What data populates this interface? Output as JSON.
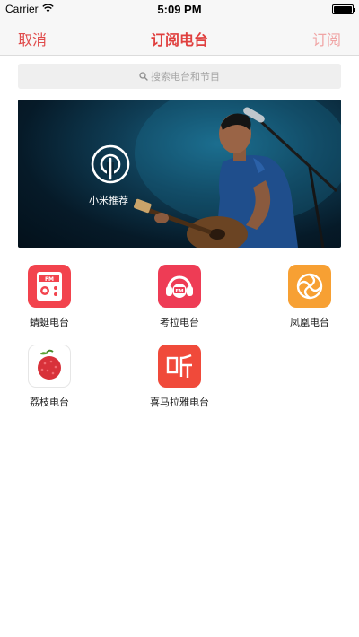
{
  "status_bar": {
    "carrier": "Carrier",
    "time": "5:09 PM"
  },
  "nav": {
    "cancel_label": "取消",
    "title": "订阅电台",
    "subscribe_label": "订阅"
  },
  "search": {
    "placeholder": "搜索电台和节目"
  },
  "banner": {
    "label": "小米推荐"
  },
  "stations": [
    {
      "name": "蜻蜓电台",
      "icon": "radio-icon",
      "color": "#f2434d"
    },
    {
      "name": "考拉电台",
      "icon": "koala-fm-icon",
      "color": "#ee3c55"
    },
    {
      "name": "凤凰电台",
      "icon": "phoenix-icon",
      "color": "#f7a033"
    },
    {
      "name": "荔枝电台",
      "icon": "lychee-icon",
      "color": "#ffffff"
    },
    {
      "name": "喜马拉雅电台",
      "icon": "ximalaya-icon",
      "color": "#f04a3a"
    }
  ],
  "colors": {
    "accent": "#e0403f",
    "accent_disabled": "#f0a5a5",
    "nav_background": "#f7f7f7",
    "search_background": "#efefef"
  }
}
